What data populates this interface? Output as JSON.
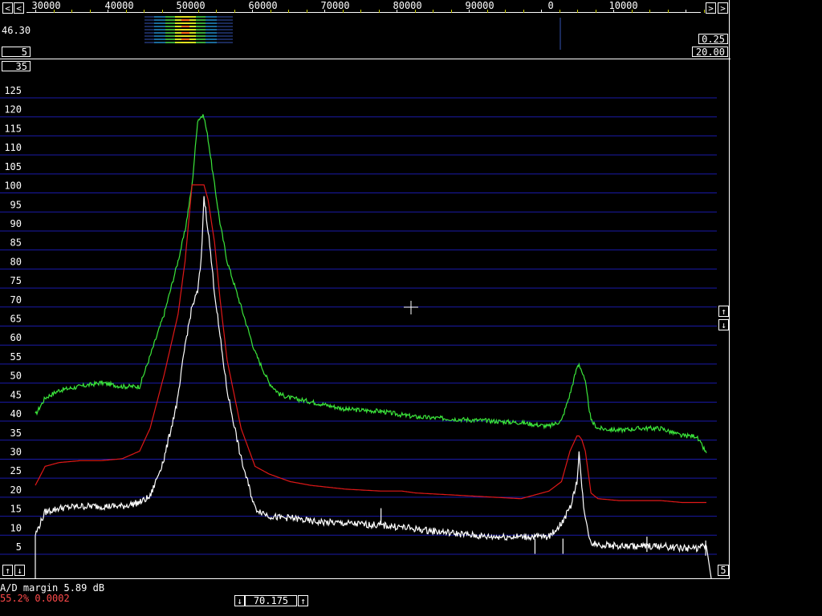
{
  "top_bar": {
    "left_arrow": "<",
    "right_arrow": ">",
    "freq_labels": [
      "30000",
      "40000",
      "50000",
      "60000",
      "70000",
      "80000",
      "90000",
      "0",
      "10000"
    ]
  },
  "waterfall": {
    "level_left": "46.30",
    "avg_box": "5",
    "gain_box": "0.25",
    "contrast_box": "20.00"
  },
  "graph": {
    "top_box": "35",
    "bottom_box": "5",
    "zoom_up": "↑",
    "zoom_down": "↓",
    "colors": {
      "grid": "#1a1aa8",
      "green": "#3be63b",
      "red": "#e01818",
      "white": "#ffffff"
    }
  },
  "status": {
    "ad_margin": "A/D margin 5.89 dB",
    "cpu": "55.2% 0.0002",
    "freq_value": "70.175",
    "freq_down": "↓",
    "freq_up": "↑"
  },
  "chart_data": {
    "type": "line",
    "ylim": [
      0,
      125
    ],
    "yticks": [
      5,
      10,
      15,
      20,
      25,
      30,
      35,
      40,
      45,
      50,
      55,
      60,
      65,
      70,
      75,
      80,
      85,
      90,
      95,
      100,
      105,
      110,
      115,
      120,
      125
    ],
    "x": [
      25600,
      27000,
      29000,
      32000,
      35000,
      38000,
      40500,
      42000,
      44000,
      46000,
      47000,
      48000,
      48800,
      49300,
      49700,
      50300,
      51200,
      52000,
      53000,
      55000,
      57000,
      59000,
      60500,
      62000,
      65000,
      70000,
      75000,
      78000,
      80000,
      85000,
      90000,
      95000,
      99000,
      100800,
      102000,
      103000,
      103300,
      103700,
      104200,
      105000,
      106000,
      109000,
      112000,
      115000,
      118000,
      120000,
      121500
    ],
    "series": [
      {
        "values": [
          39.5,
          44,
          46,
          47,
          48,
          47,
          47,
          55,
          66,
          80,
          88,
          100,
          117,
          118,
          118,
          112,
          100,
          90,
          80,
          68,
          56,
          48,
          45,
          44,
          43,
          41,
          40.5,
          39.5,
          39,
          38.5,
          38,
          37.5,
          36.5,
          38,
          45,
          52,
          53,
          51,
          48,
          38,
          36,
          35.5,
          36,
          36,
          34,
          34,
          29.5
        ]
      },
      {
        "values": [
          21,
          26,
          27,
          27.5,
          27.5,
          28,
          30,
          36,
          50,
          66,
          80,
          100,
          100,
          100,
          100,
          96,
          85,
          70,
          54,
          36,
          26,
          24,
          23,
          22,
          21,
          20,
          19.5,
          19.5,
          19,
          18.5,
          18,
          17.5,
          19.5,
          22,
          30,
          34,
          34,
          33,
          30,
          19,
          17.5,
          17,
          17,
          17,
          16.5,
          16.5,
          16.5
        ]
      },
      {
        "values": [
          8,
          14,
          15,
          15.5,
          15.5,
          15.5,
          16.5,
          18,
          28,
          44,
          58,
          68,
          72,
          80,
          97,
          88,
          72,
          60,
          46,
          28,
          15,
          13,
          12.5,
          12.5,
          11.5,
          11,
          10.5,
          10,
          9.5,
          8.5,
          7.5,
          7.5,
          7.5,
          11,
          15,
          22,
          30,
          20,
          12,
          6,
          5.5,
          5,
          5,
          5,
          4.5,
          4.5,
          5
        ]
      }
    ]
  }
}
